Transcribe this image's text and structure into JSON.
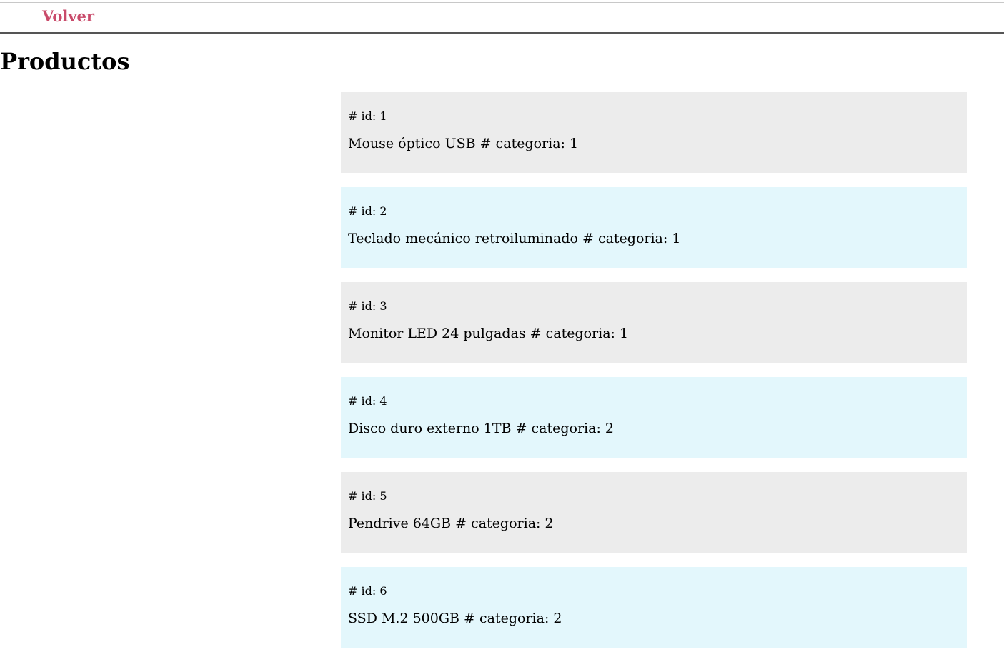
{
  "nav": {
    "back_label": "Volver"
  },
  "page": {
    "title": "Productos"
  },
  "products": [
    {
      "id_text": "# id: 1",
      "name": "Mouse óptico USB",
      "category_text": "# categoria: 1"
    },
    {
      "id_text": "# id: 2",
      "name": "Teclado mecánico retroiluminado",
      "category_text": "# categoria: 1"
    },
    {
      "id_text": "# id: 3",
      "name": "Monitor LED 24 pulgadas",
      "category_text": "# categoria: 1"
    },
    {
      "id_text": "# id: 4",
      "name": "Disco duro externo 1TB",
      "category_text": "# categoria: 2"
    },
    {
      "id_text": "# id: 5",
      "name": "Pendrive 64GB",
      "category_text": "# categoria: 2"
    },
    {
      "id_text": "# id: 6",
      "name": "SSD M.2 500GB",
      "category_text": "# categoria: 2"
    }
  ],
  "colors": {
    "link": "#c94a6a",
    "card_gray": "#ececec",
    "card_cyan": "#e3f7fc"
  }
}
